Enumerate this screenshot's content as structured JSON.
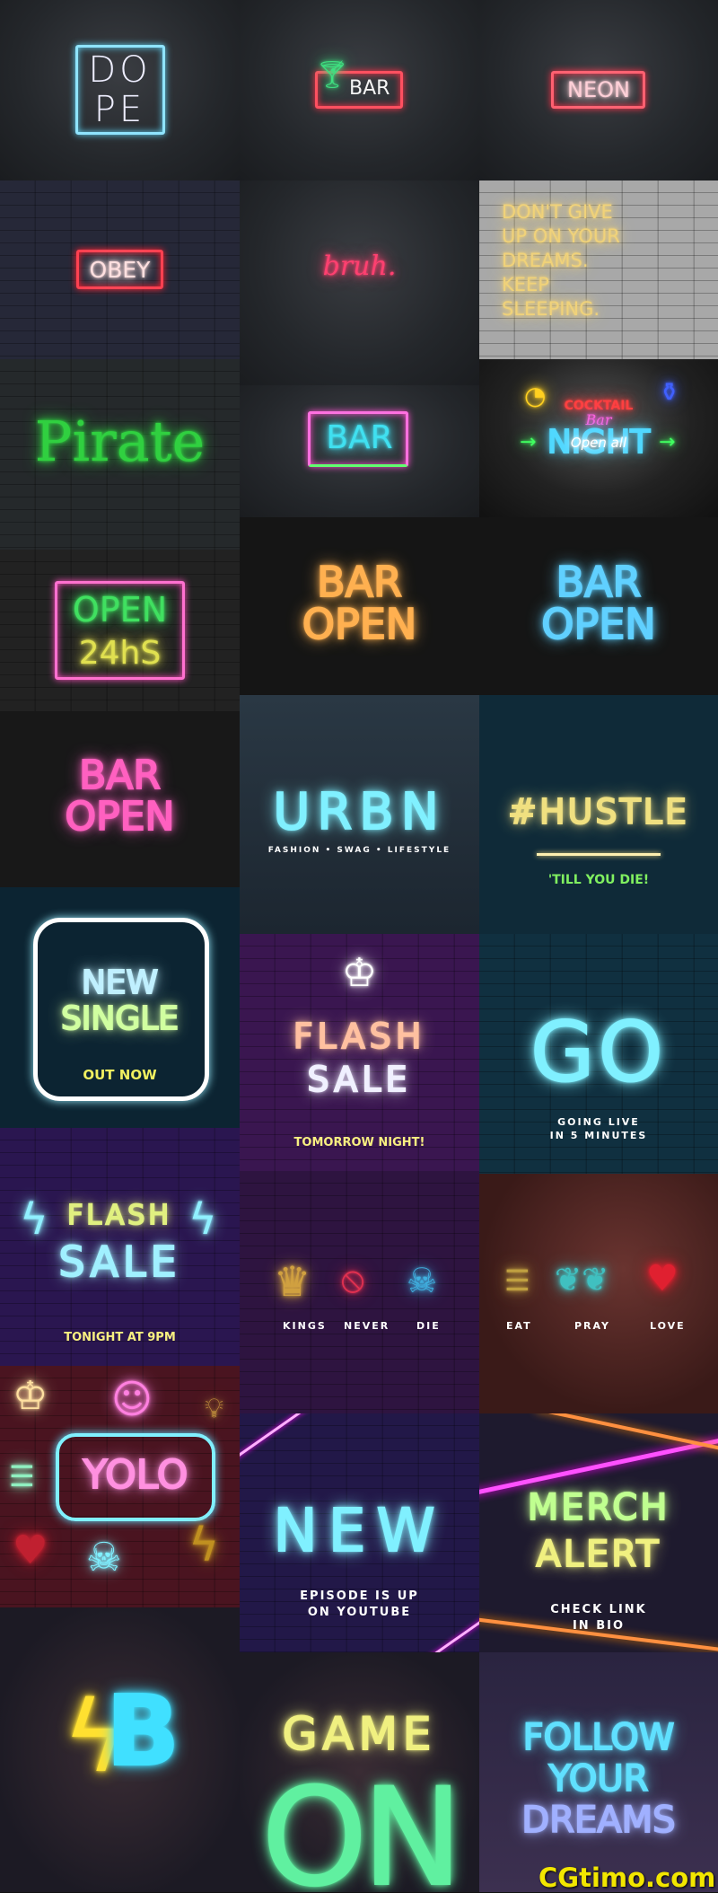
{
  "tiles": {
    "dope": {
      "line1": "DO",
      "line2": "PE"
    },
    "cocktail_bar": {
      "text": "BAR",
      "icon": "martini-glass-icon"
    },
    "neon": {
      "text": "NEON"
    },
    "obey": {
      "text": "OBEY"
    },
    "bruh": {
      "text": "bruh."
    },
    "dont_give_up": {
      "lines": [
        "DON'T GIVE",
        "UP ON YOUR",
        "DREAMS.",
        "KEEP",
        "SLEEPING."
      ]
    },
    "pirate": {
      "text": "Pirate"
    },
    "bar_box": {
      "text": "BAR"
    },
    "cocktail_night": {
      "line1": "COCKTAIL",
      "line2": "Bar",
      "line3": "NIGHT",
      "line4": "Open all"
    },
    "open24": {
      "line1": "OPEN",
      "line2": "24hS"
    },
    "bar_open_orange": {
      "line1": "BAR",
      "line2": "OPEN"
    },
    "bar_open_blue": {
      "line1": "BAR",
      "line2": "OPEN"
    },
    "bar_open_pink": {
      "line1": "BAR",
      "line2": "OPEN"
    },
    "urbn": {
      "title": "URBN",
      "caption": "FASHION • SWAG • LIFESTYLE"
    },
    "hustle": {
      "title": "#HUSTLE",
      "caption": "'TILL YOU DIE!"
    },
    "new_single": {
      "line1": "NEW",
      "line2": "SINGLE",
      "caption": "OUT NOW"
    },
    "flash_crown": {
      "line1": "FLASH",
      "line2": "SALE",
      "caption": "TOMORROW NIGHT!"
    },
    "go": {
      "title": "GO",
      "caption1": "GOING LIVE",
      "caption2": "IN 5 MINUTES"
    },
    "flash_tonight": {
      "line1": "FLASH",
      "line2": "SALE",
      "caption": "TONIGHT AT 9PM"
    },
    "kings": {
      "labels": [
        "KINGS",
        "NEVER",
        "DIE"
      ]
    },
    "eat": {
      "labels": [
        "EAT",
        "PRAY",
        "LOVE"
      ]
    },
    "yolo": {
      "text": "YOLO"
    },
    "new_episode": {
      "title": "NEW",
      "caption1": "EPISODE IS UP",
      "caption2": "ON YOUTUBE"
    },
    "merch": {
      "line1": "MERCH",
      "line2": "ALERT",
      "caption1": "CHECK LINK",
      "caption2": "IN BIO"
    },
    "game_on": {
      "line1": "GAME",
      "line2": "ON"
    },
    "follow": {
      "lines": [
        "FOLLOW",
        "YOUR",
        "DREAMS"
      ]
    }
  },
  "watermark": "CGtimo.com",
  "colors": {
    "watermark": "#f2e600",
    "neon_red": "#ff3048",
    "neon_blue": "#5fd8ff",
    "neon_pink": "#ff5fc8",
    "neon_orange": "#ffb050",
    "neon_green": "#3fe060"
  }
}
